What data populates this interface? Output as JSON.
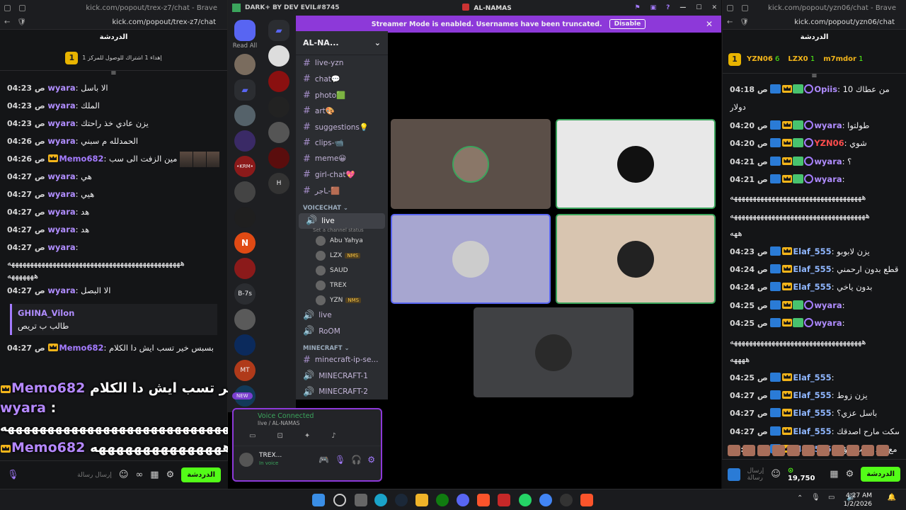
{
  "kick_left": {
    "window_title": "kick.com/popout/trex-z7/chat - Brave",
    "url": "kick.com/popout/trex-z7/chat",
    "chat_title": "الدردشة",
    "goal_text": "إهداء 1 اشتراك للوصول للمركز 1",
    "goal_rank": "1",
    "messages": [
      {
        "time": "04:23 ص",
        "user": "wyara",
        "text": "الا باسل"
      },
      {
        "time": "04:23 ص",
        "user": "wyara",
        "text": "الملك"
      },
      {
        "time": "04:23 ص",
        "user": "wyara",
        "text": "يزن عادي خذ راحتك"
      },
      {
        "time": "04:26 ص",
        "user": "wyara",
        "text": "الحمدلله م سبني"
      },
      {
        "time": "04:26 ص",
        "user": "Memo682",
        "text": "مين الزفت الى سب"
      },
      {
        "time": "04:27 ص",
        "user": "wyara",
        "text": "هي"
      },
      {
        "time": "04:27 ص",
        "user": "wyara",
        "text": "هيي"
      },
      {
        "time": "04:27 ص",
        "user": "wyara",
        "text": "هد"
      },
      {
        "time": "04:27 ص",
        "user": "wyara",
        "text": "هد"
      },
      {
        "time": "04:27 ص",
        "user": "wyara",
        "text": ""
      },
      {
        "time": "04:27 ص",
        "user": "wyara",
        "text": "الا البصل"
      }
    ],
    "long_text": "ههههههههههههههههههههههههههههههههههههههههههههههه",
    "long_text_2": "هههههههه",
    "reply_user": "GHINA_Vilon",
    "reply_text": "طالب ب تريص",
    "last_msg": {
      "time": "04:27 ص",
      "user": "Memo682",
      "text": "بسبس خير تسب ايش دا الكلام"
    },
    "overlay": {
      "line1_user": "Memo682",
      "line1_text": "بسبس خير تسب ايش دا الكلام :",
      "line2_user": "wyara",
      "line3_user": "Memo682",
      "line3_text": "هههههههههههههههه :"
    },
    "new_label": "NEW",
    "chat_btn": "الدردشة",
    "send_placeholder": "إرسال رسالة"
  },
  "discord": {
    "top_title": "DARK+ BY DEV EVIL#8745",
    "server_title": "AL-NAMAS",
    "server_short": "AL-NA...",
    "read_all": "Read All",
    "b7s": "B-7s",
    "banner_text": "Streamer Mode is enabled. Usernames have been truncated.",
    "banner_btn": "Disable",
    "channels": [
      "live-yzn",
      "chat💬",
      "photo🟩",
      "art🎨",
      "suggestions💡",
      "clips-📹",
      "meme😀",
      "girl-chat💖",
      "ـاجر-🟫"
    ],
    "voice_category": "VOICECHAT",
    "voice_channel": "live",
    "voice_status": "Set a channel status",
    "voice_users": [
      {
        "name": "Abu Yahya",
        "badge": ""
      },
      {
        "name": "LZX",
        "badge": "NMS"
      },
      {
        "name": "SAUD",
        "badge": ""
      },
      {
        "name": "TREX",
        "badge": ""
      },
      {
        "name": "YZN",
        "badge": "NMS"
      }
    ],
    "more_voice": [
      "live",
      "RoOM"
    ],
    "mc_category": "MINECRAFT",
    "mc_channels": [
      "minecraft-ip-se...",
      "MINECRAFT-1",
      "MINECRAFT-2"
    ],
    "new_badge": "NEW",
    "voice_connected": "Voice Connected",
    "voice_sub": "live / AL-NAMAS",
    "user_name": "TREX...",
    "user_status": "In voice"
  },
  "kick_right": {
    "window_title": "kick.com/popout/yzn06/chat - Brave",
    "url": "kick.com/popout/yzn06/chat",
    "chat_title": "الدردشة",
    "top_users": [
      {
        "name": "YZN06",
        "count": "6"
      },
      {
        "name": "LZX0",
        "count": "1"
      },
      {
        "name": "m7mdor",
        "count": "1"
      }
    ],
    "rank": "1",
    "messages": [
      {
        "time": "04:18 ص",
        "user": "Opiis",
        "text": "من عطاك 10"
      },
      {
        "time": "",
        "user": "",
        "text": "دولار"
      },
      {
        "time": "04:20 ص",
        "user": "wyara",
        "text": "طولتوا"
      },
      {
        "time": "04:20 ص",
        "user": "YZN06",
        "text": "شوي"
      },
      {
        "time": "04:21 ص",
        "user": "wyara",
        "text": "؟"
      },
      {
        "time": "04:21 ص",
        "user": "wyara",
        "text": ""
      },
      {
        "time": "",
        "user": "",
        "text": "هههههههههههههههههههههههههههههههههههه"
      },
      {
        "time": "",
        "user": "",
        "text": "ههههههههههههههههههههههههههههههههههههه"
      },
      {
        "time": "",
        "user": "",
        "text": "ههه"
      },
      {
        "time": "04:23 ص",
        "user": "Elaf_555",
        "text": "يزن لابوبو"
      },
      {
        "time": "04:24 ص",
        "user": "Elaf_555",
        "text": "لا اقطع بدون ارحمني"
      },
      {
        "time": "04:24 ص",
        "user": "Elaf_555",
        "text": "بدون ياخي"
      },
      {
        "time": "04:25 ص",
        "user": "wyara",
        "text": ""
      },
      {
        "time": "04:25 ص",
        "user": "wyara",
        "text": ""
      },
      {
        "time": "",
        "user": "",
        "text": "هههههههههههههههههههههههههههههههههههه"
      },
      {
        "time": "",
        "user": "",
        "text": "ههههه"
      },
      {
        "time": "04:25 ص",
        "user": "Elaf_555",
        "text": ""
      },
      {
        "time": "04:27 ص",
        "user": "Elaf_555",
        "text": "يزن زوط"
      },
      {
        "time": "04:27 ص",
        "user": "Elaf_555",
        "text": "باسل عزي؟"
      },
      {
        "time": "04:27 ص",
        "user": "Elaf_555",
        "text": "يزن اسكت مارح اصدقك"
      },
      {
        "time": "04:27 ص",
        "user": "Elaf_555",
        "text": "مع بعد كذبت مؤيد"
      }
    ],
    "points": "19,750",
    "chat_btn": "الدردشة",
    "send_placeholder": "إرسال رسالة"
  },
  "taskbar": {
    "time": "4:27 AM",
    "date": "1/2/2026"
  },
  "colors": {
    "kick_green": "#53fc18",
    "discord_purple": "#8d39d9",
    "crown": "#f3b51a"
  }
}
